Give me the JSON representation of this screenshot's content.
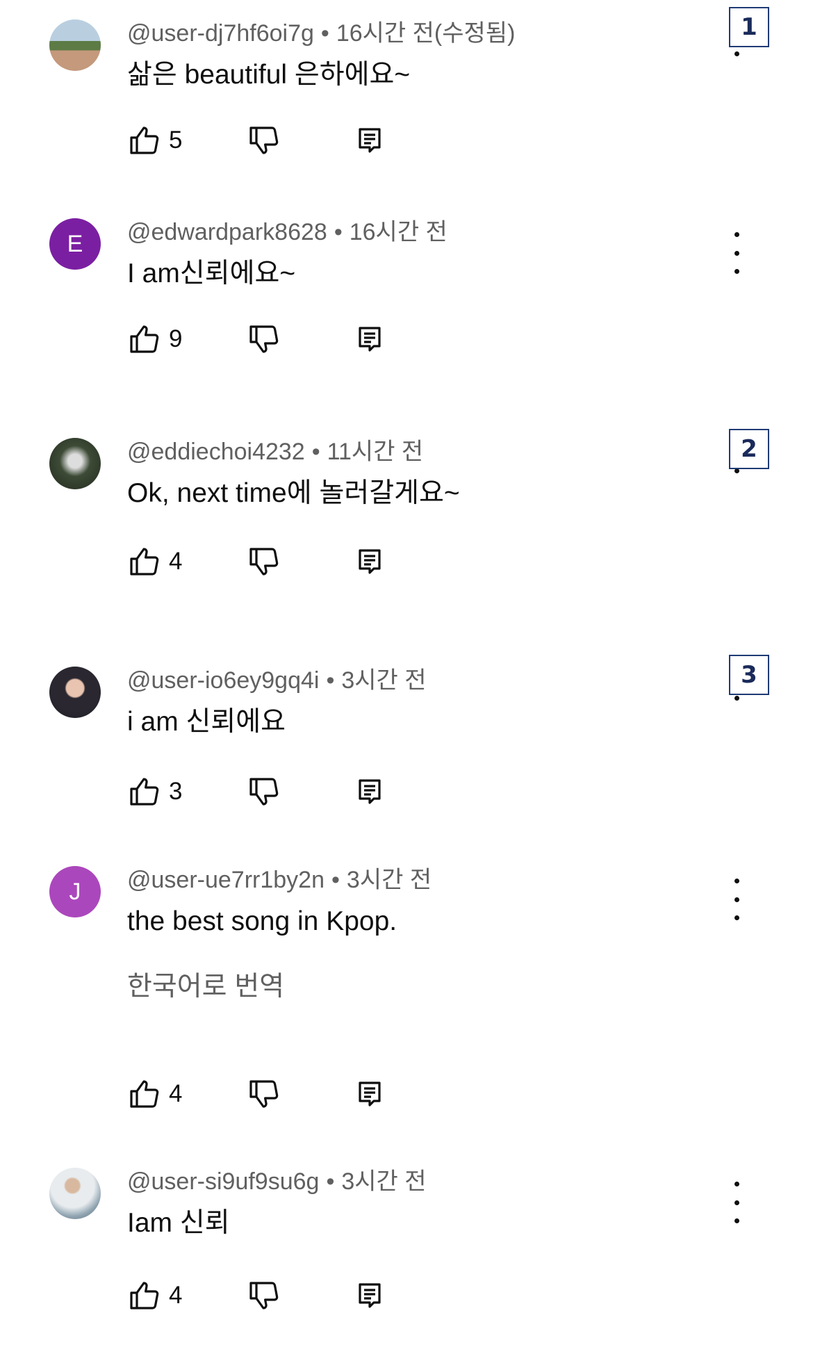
{
  "comments": [
    {
      "username": "@user-dj7hf6oi7g",
      "time": "16시간 전(수정됨)",
      "text": "삶은 beautiful 은하에요~",
      "likes": "5",
      "avatar": {
        "type": "image",
        "style": "landscape"
      }
    },
    {
      "username": "@edwardpark8628",
      "time": "16시간 전",
      "text": "I am신뢰에요~",
      "likes": "9",
      "avatar": {
        "type": "letter",
        "letter": "E",
        "color": "#7b1fa2"
      }
    },
    {
      "username": "@eddiechoi4232",
      "time": "11시간 전",
      "text": "Ok, next time에 놀러갈게요~",
      "likes": "4",
      "avatar": {
        "type": "image",
        "style": "forest"
      }
    },
    {
      "username": "@user-io6ey9gq4i",
      "time": "3시간 전",
      "text": "i am 신뢰에요",
      "likes": "3",
      "avatar": {
        "type": "image",
        "style": "portrait"
      }
    },
    {
      "username": "@user-ue7rr1by2n",
      "time": "3시간 전",
      "text": "the best song in Kpop.",
      "translate_label": "한국어로 번역",
      "likes": "4",
      "avatar": {
        "type": "letter",
        "letter": "J",
        "color": "#ab47bc"
      }
    },
    {
      "username": "@user-si9uf9su6g",
      "time": "3시간 전",
      "text": "Iam 신뢰",
      "likes": "4",
      "avatar": {
        "type": "image",
        "style": "person"
      }
    }
  ],
  "badges": [
    "1",
    "2",
    "3"
  ],
  "separator": "•"
}
